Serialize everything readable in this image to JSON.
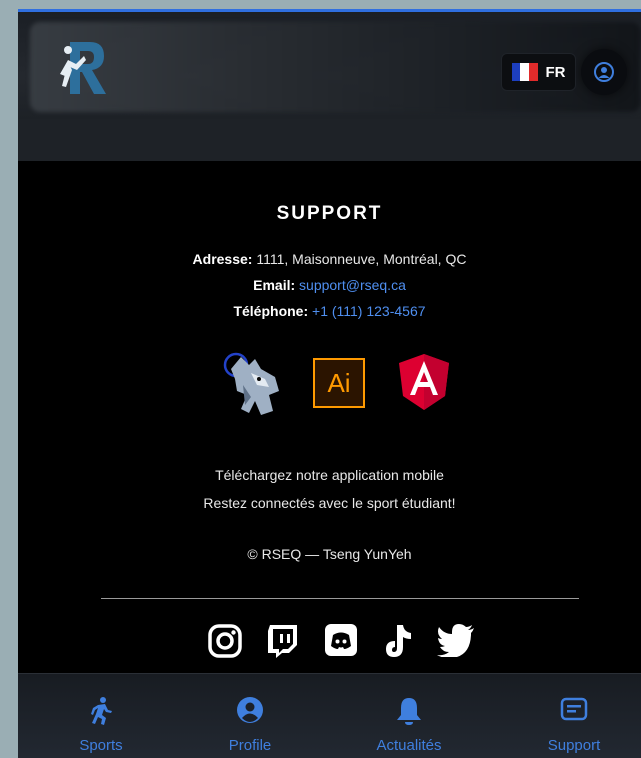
{
  "header": {
    "language_label": "FR"
  },
  "support": {
    "title": "SUPPORT",
    "address_label": "Adresse:",
    "address_value": "1111, Maisonneuve, Montréal, QC",
    "email_label": "Email:",
    "email_value": "support@rseq.ca",
    "phone_label": "Téléphone:",
    "phone_value": "+1 (111) 123-4567",
    "logo_ai_text": "Ai",
    "app_line1": "Téléchargez notre application mobile",
    "app_line2": "Restez connectés avec le sport étudiant!",
    "copyright": "© RSEQ — Tseng YunYeh"
  },
  "social_icons": [
    "instagram-icon",
    "twitch-icon",
    "discord-icon",
    "tiktok-icon",
    "twitter-icon"
  ],
  "nav": {
    "items": [
      {
        "label": "Sports",
        "icon": "runner-icon"
      },
      {
        "label": "Profile",
        "icon": "user-icon"
      },
      {
        "label": "Actualités",
        "icon": "bell-icon"
      },
      {
        "label": "Support",
        "icon": "message-icon"
      }
    ]
  },
  "colors": {
    "accent": "#3f7fde",
    "link": "#4f8ff0",
    "illustrator_orange": "#ff9a00",
    "angular_red": "#dd0031"
  }
}
